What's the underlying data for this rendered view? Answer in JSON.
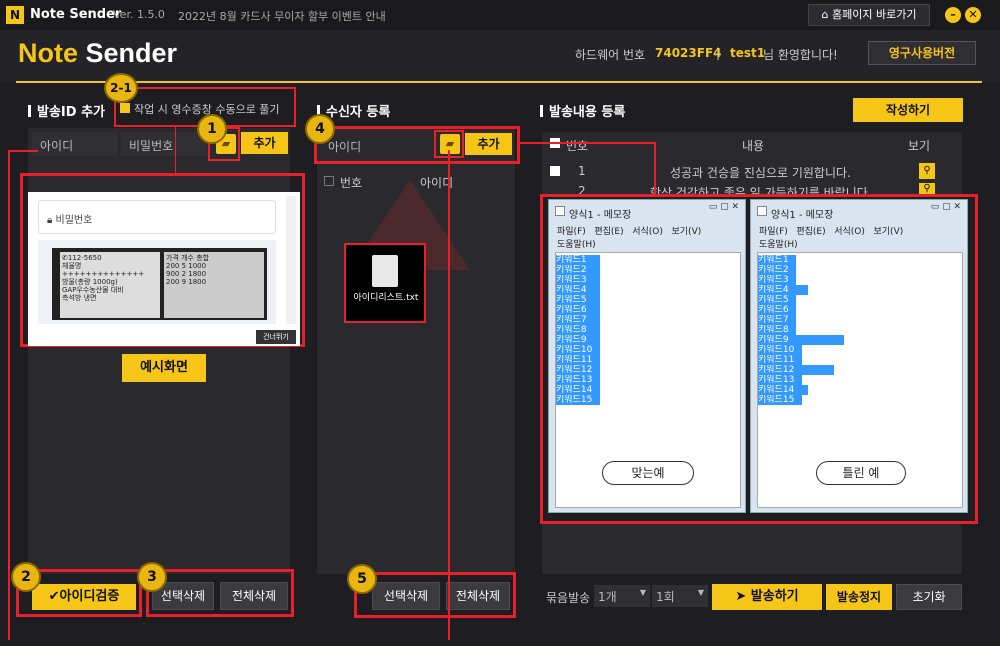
{
  "app": {
    "logo_letter": "N",
    "name": "Note Sender",
    "version": "Ver. 1.5.0",
    "notice": "2022년 8월 카드사 무이자 할부 이벤트 안내",
    "home_button": "홈페이지 바로가기",
    "brand_note": "Note",
    "brand_sender": "Sender"
  },
  "header": {
    "hw_label": "하드웨어 번호",
    "hw_value": "74023FF4",
    "separator": "|",
    "user": "test1",
    "welcome": "님 환영합니다!",
    "license_button": "영구사용버전"
  },
  "left": {
    "title": "발송ID 추가",
    "checkbox_label": "작업 시 영수증창 수동으로 풀기",
    "id_placeholder": "아이디",
    "pw_placeholder": "비밀번호",
    "add_button": "추가",
    "example_field_label": "비밀번호",
    "receipt_lines": [
      "✆112-5650",
      "체율명",
      "가격 개수 총합",
      "++++++++++++++",
      "200 5 1000",
      "방울(총량 1000g)",
      "900 2 1800",
      "GAP우수농산물 대비",
      "200 9 1800",
      "측석방 냉면"
    ],
    "skip_button": "건너뛰기",
    "example_caption": "예시화면",
    "verify_button": "아이디검증",
    "delete_selected": "선택삭제",
    "delete_all": "전체삭제"
  },
  "middle": {
    "title": "수신자 등록",
    "id_placeholder": "아이디",
    "add_button": "추가",
    "col_no": "번호",
    "col_id": "아이디",
    "file_name": "아이디리스트.txt",
    "delete_selected": "선택삭제",
    "delete_all": "전체삭제"
  },
  "right": {
    "title": "발송내용 등록",
    "write_button": "작성하기",
    "col_no": "번호",
    "col_content": "내용",
    "col_view": "보기",
    "rows": [
      {
        "no": "1",
        "content": "성공과 건승을 진심으로 기원합니다."
      },
      {
        "no": "2",
        "content": "항상 건강하고 좋은 일 가득하기를 바랍니다."
      }
    ],
    "bundle_label": "묶음발송",
    "bundle_value": "1개",
    "times_value": "1회",
    "send_button": "발송하기",
    "stop_button": "발송정지",
    "reset_button": "초기화"
  },
  "notepad": {
    "title": "양식1 - 메모장",
    "menu": [
      "파일(F)",
      "편집(E)",
      "서식(O)",
      "보기(V)",
      "도움말(H)"
    ],
    "correct_lines": [
      "키워드1",
      "키워드2",
      "키워드3",
      "키워드4",
      "키워드5",
      "키워드6",
      "키워드7",
      "키워드8",
      "키워드9",
      "키워드10",
      "키워드11",
      "키워드12",
      "키워드13",
      "키워드14",
      "키워드15"
    ],
    "wrong_lines": [
      "키워드1",
      "키워드2",
      "키워드3",
      "키워드4",
      "키워드5",
      "키워드6",
      "키워드7",
      "키워드8",
      "키워드9",
      "키워드10",
      "키워드11",
      "키워드12",
      "키워드13",
      "키워드14",
      "키워드15"
    ],
    "correct_label": "맞는예",
    "wrong_label": "틀린 예"
  },
  "badges": {
    "b1": "1",
    "b2_1": "2-1",
    "b2": "2",
    "b3": "3",
    "b4": "4",
    "b5": "5"
  },
  "colors": {
    "accent": "#f5c518",
    "highlight": "#e8202a",
    "background": "#1e1e22"
  }
}
